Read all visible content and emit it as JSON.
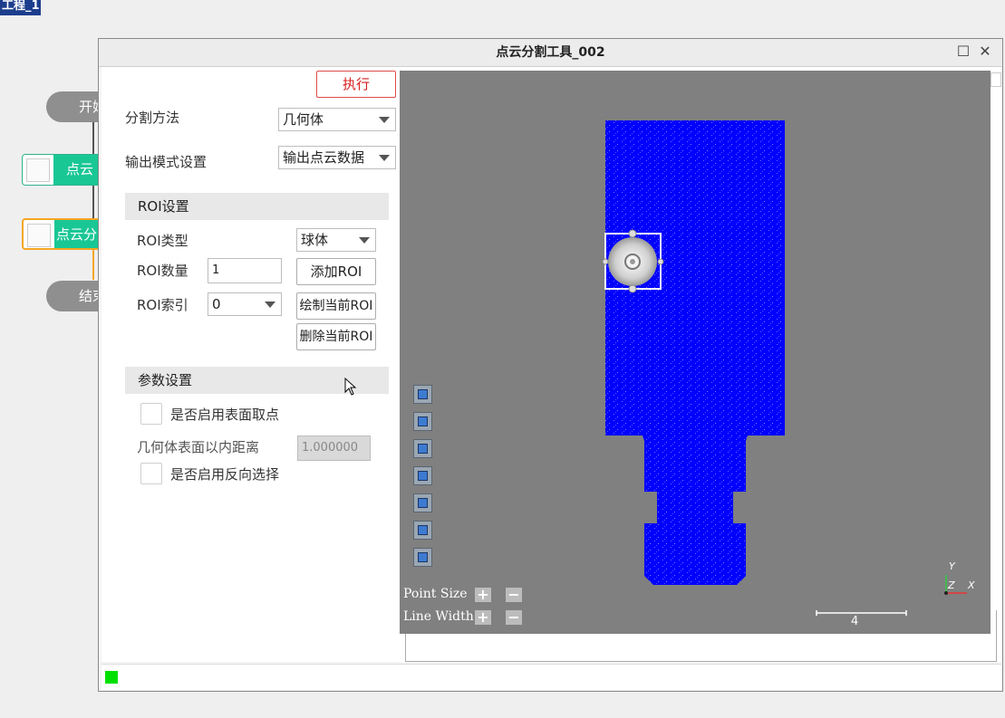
{
  "background": {
    "project_tab": "工程_1",
    "flow": {
      "start_label": "开始",
      "node1_label": "点云",
      "node2_label": "点云分",
      "end_label": "结束"
    }
  },
  "dialog": {
    "title": "点云分割工具_002",
    "execute_label": "执行",
    "segmentation_method_label": "分割方法",
    "segmentation_method_value": "几何体",
    "output_mode_label": "输出模式设置",
    "output_mode_value": "输出点云数据",
    "roi_section": "ROI设置",
    "roi_type_label": "ROI类型",
    "roi_type_value": "球体",
    "roi_count_label": "ROI数量",
    "roi_count_value": "1",
    "add_roi_label": "添加ROI",
    "roi_index_label": "ROI索引",
    "roi_index_value": "0",
    "draw_roi_label": "绘制当前ROI",
    "delete_roi_label": "删除当前ROI",
    "param_section": "参数设置",
    "surface_sampling_label": "是否启用表面取点",
    "inner_distance_label": "几何体表面以内距离",
    "inner_distance_value": "1.000000",
    "reverse_select_label": "是否启用反向选择"
  },
  "viewer": {
    "point_size_label": "Point Size",
    "line_width_label": "Line Width",
    "scale_value": "4",
    "axis_y": "Y",
    "axis_z": "Z",
    "axis_x": "X",
    "cloud_color": "#0000ff",
    "background_color": "#808080"
  },
  "status": {
    "indicator_color": "#00e000"
  }
}
